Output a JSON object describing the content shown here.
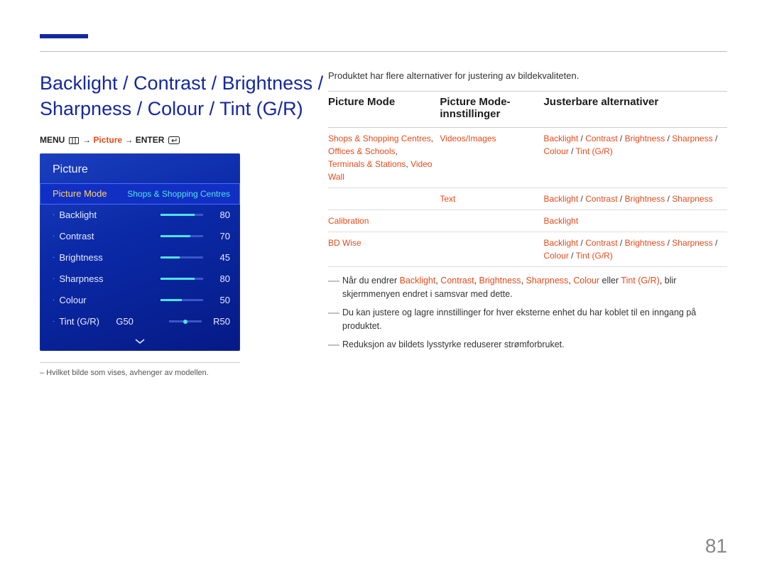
{
  "page_number": "81",
  "heading": "Backlight / Contrast / Brightness / Sharpness / Colour / Tint (G/R)",
  "menu_path": {
    "prefix": "MENU",
    "mid": "Picture",
    "suffix": "ENTER"
  },
  "osd": {
    "title": "Picture",
    "selected_label": "Picture Mode",
    "selected_value": "Shops & Shopping Centres",
    "rows": [
      {
        "label": "Backlight",
        "value": "80",
        "pct": 80
      },
      {
        "label": "Contrast",
        "value": "70",
        "pct": 70
      },
      {
        "label": "Brightness",
        "value": "45",
        "pct": 45
      },
      {
        "label": "Sharpness",
        "value": "80",
        "pct": 80
      },
      {
        "label": "Colour",
        "value": "50",
        "pct": 50
      }
    ],
    "tint": {
      "label": "Tint (G/R)",
      "left": "G50",
      "right": "R50",
      "pos": 50
    }
  },
  "footnote": "–  Hvilket bilde som vises, avhenger av modellen.",
  "intro": "Produktet har flere alternativer for justering av bildekvaliteten.",
  "table": {
    "headers": [
      "Picture Mode",
      "Picture Mode-innstillinger",
      "Justerbare alternativer"
    ],
    "rows": [
      {
        "col1_items": [
          "Shops & Shopping Centres",
          "Offices & Schools",
          "Terminals & Stations",
          "Video Wall"
        ],
        "col2": "Videos/Images",
        "col3_items": [
          "Backlight",
          "Contrast",
          "Brightness",
          "Sharpness",
          "Colour",
          "Tint (G/R)"
        ]
      },
      {
        "col1_items": [],
        "col2": "Text",
        "col3_items": [
          "Backlight",
          "Contrast",
          "Brightness",
          "Sharpness"
        ]
      },
      {
        "col1_items": [
          "Calibration"
        ],
        "col2": "",
        "col3_items": [
          "Backlight"
        ]
      },
      {
        "col1_items": [
          "BD Wise"
        ],
        "col2": "",
        "col3_items": [
          "Backlight",
          "Contrast",
          "Brightness",
          "Sharpness",
          "Colour",
          "Tint (G/R)"
        ]
      }
    ]
  },
  "notes": [
    {
      "segments": [
        {
          "t": "Når du endrer "
        },
        {
          "t": "Backlight",
          "a": true
        },
        {
          "t": ", "
        },
        {
          "t": "Contrast",
          "a": true
        },
        {
          "t": ", "
        },
        {
          "t": "Brightness",
          "a": true
        },
        {
          "t": ", "
        },
        {
          "t": "Sharpness",
          "a": true
        },
        {
          "t": ", "
        },
        {
          "t": "Colour",
          "a": true
        },
        {
          "t": " eller "
        },
        {
          "t": "Tint (G/R)",
          "a": true
        },
        {
          "t": ", blir skjermmenyen endret i samsvar med dette."
        }
      ]
    },
    {
      "segments": [
        {
          "t": "Du kan justere og lagre innstillinger for hver eksterne enhet du har koblet til en inngang på produktet."
        }
      ]
    },
    {
      "segments": [
        {
          "t": "Reduksjon av bildets lysstyrke reduserer strømforbruket."
        }
      ]
    }
  ]
}
